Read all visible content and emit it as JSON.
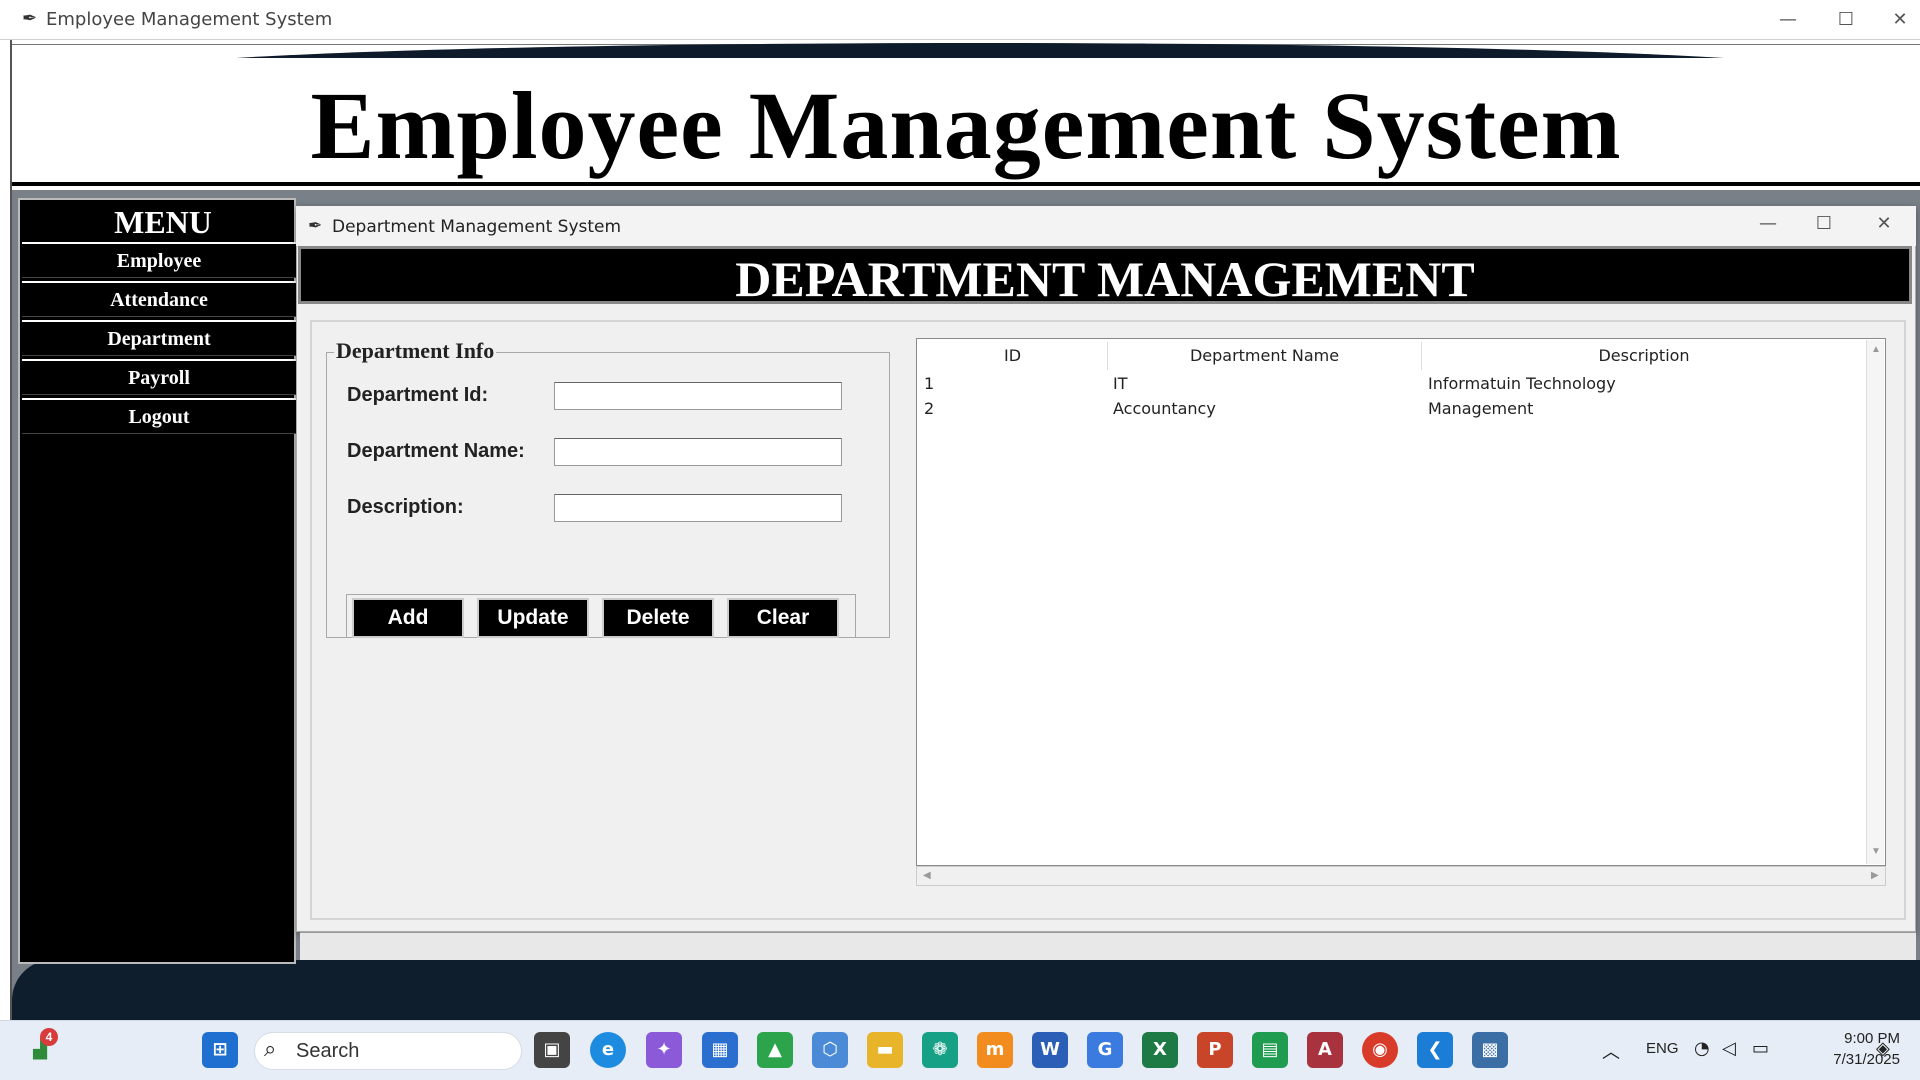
{
  "outer_window": {
    "title": "Employee Management System",
    "controls": {
      "minimize": "—",
      "maximize": "☐",
      "close": "✕"
    }
  },
  "header": {
    "title": "Employee Management System"
  },
  "sidebar": {
    "title": "MENU",
    "items": [
      {
        "label": "Employee"
      },
      {
        "label": "Attendance"
      },
      {
        "label": "Department"
      },
      {
        "label": "Payroll"
      },
      {
        "label": "Logout"
      }
    ]
  },
  "dept_window": {
    "title": "Department Management System",
    "controls": {
      "minimize": "—",
      "maximize": "☐",
      "close": "✕"
    },
    "banner": "DEPARTMENT MANAGEMENT",
    "form": {
      "legend": "Department Info",
      "fields": [
        {
          "label": "Department Id:",
          "value": ""
        },
        {
          "label": "Department Name:",
          "value": ""
        },
        {
          "label": "Description:",
          "value": ""
        }
      ],
      "buttons": {
        "add": "Add",
        "update": "Update",
        "delete": "Delete",
        "clear": "Clear"
      }
    },
    "table": {
      "columns": [
        "ID",
        "Department Name",
        "Description"
      ],
      "rows": [
        [
          "1",
          "IT",
          "Informatuin Technology"
        ],
        [
          "2",
          "Accountancy",
          "Management"
        ]
      ]
    }
  },
  "taskbar": {
    "search_placeholder": "Search",
    "notification_count": "4",
    "language": "ENG",
    "time": "9:00 PM",
    "date": "7/31/2025",
    "icons": [
      "stocks-icon",
      "windows-start-icon",
      "task-view-icon",
      "edge-icon",
      "copilot-icon",
      "store-icon",
      "drive-icon",
      "cube-app-icon",
      "file-explorer-icon",
      "chatgpt-icon",
      "moodle-icon",
      "word-icon",
      "translate-icon",
      "excel-icon",
      "powerpoint-icon",
      "classroom-icon",
      "access-icon",
      "chrome-icon",
      "vscode-icon",
      "python-icon"
    ]
  }
}
